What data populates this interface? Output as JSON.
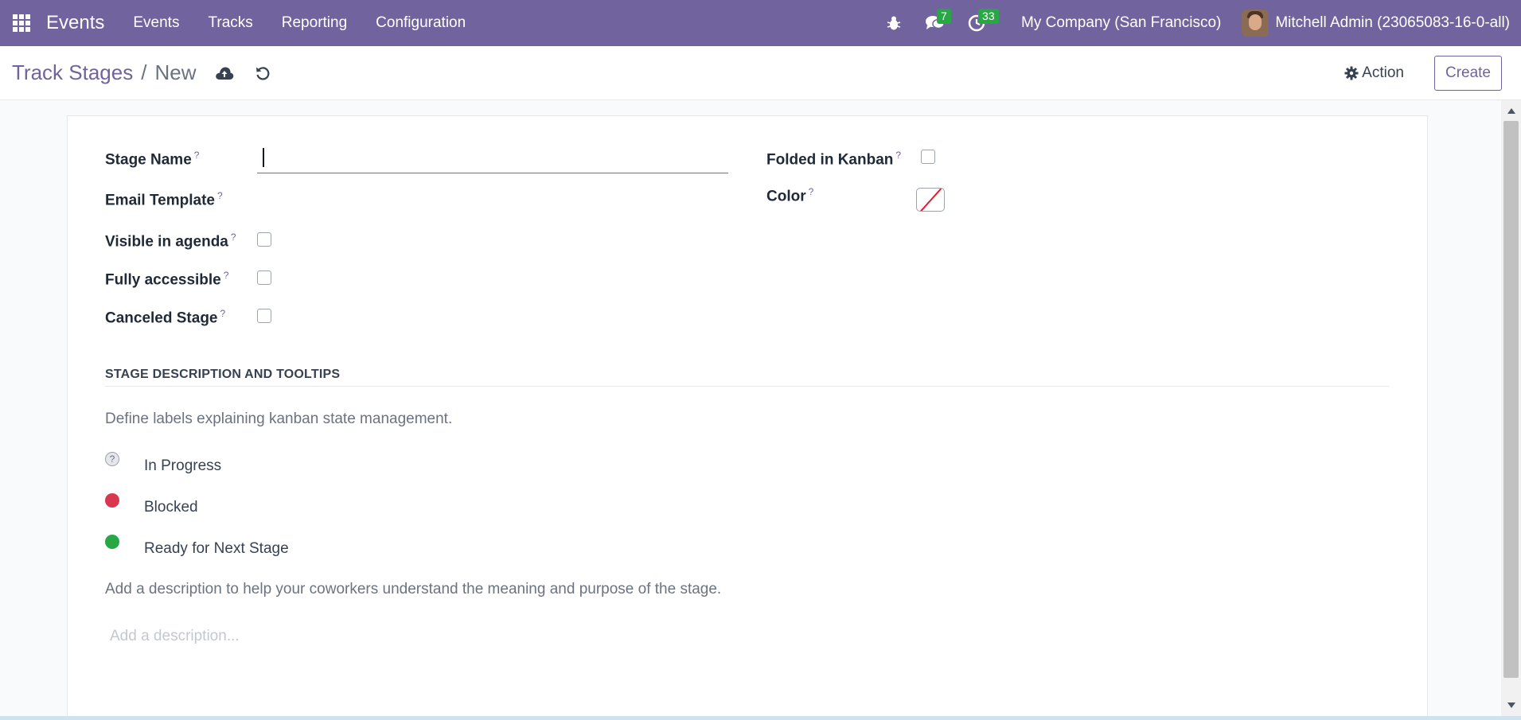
{
  "navbar": {
    "app_name": "Events",
    "menu": [
      "Events",
      "Tracks",
      "Reporting",
      "Configuration"
    ],
    "messages_count": "7",
    "activities_count": "33",
    "company": "My Company (San Francisco)",
    "user": "Mitchell Admin (23065083-16-0-all)"
  },
  "control_panel": {
    "breadcrumb_parent": "Track Stages",
    "breadcrumb_separator": "/",
    "breadcrumb_current": "New",
    "action_label": "Action",
    "create_label": "Create"
  },
  "form": {
    "stage_name_label": "Stage Name",
    "stage_name_value": "",
    "email_template_label": "Email Template",
    "visible_in_agenda_label": "Visible in agenda",
    "fully_accessible_label": "Fully accessible",
    "canceled_stage_label": "Canceled Stage",
    "folded_in_kanban_label": "Folded in Kanban",
    "color_label": "Color",
    "help_mark": "?",
    "section_title": "STAGE DESCRIPTION AND TOOLTIPS",
    "section_hint": "Define labels explaining kanban state management.",
    "states": [
      {
        "label": "In Progress",
        "color": "#e5e7eb"
      },
      {
        "label": "Blocked",
        "color": "#d9364f"
      },
      {
        "label": "Ready for Next Stage",
        "color": "#28a745"
      }
    ],
    "description_hint": "Add a description to help your coworkers understand the meaning and purpose of the stage.",
    "description_placeholder": "Add a description..."
  },
  "colors": {
    "brand": "#71639e",
    "badge": "#28a745"
  }
}
